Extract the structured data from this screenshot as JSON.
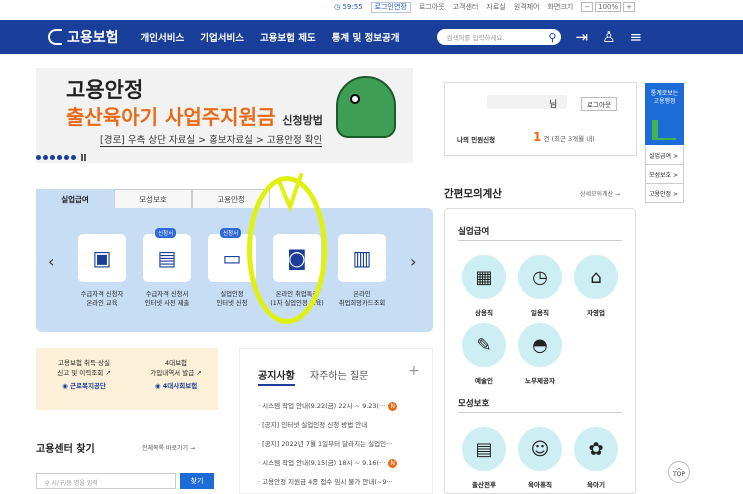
{
  "topbar": {
    "timer": "59:55",
    "extend": "로그인연장",
    "links": [
      "로그아웃",
      "고객센터",
      "자료실",
      "원격제어"
    ],
    "zoom_label": "화면크기",
    "zoom_minus": "−",
    "zoom_value": "100%",
    "zoom_plus": "+"
  },
  "header": {
    "logo": "고용보험",
    "nav": [
      "개인서비스",
      "기업서비스",
      "고용보험 제도",
      "통계 및 정보공개"
    ],
    "search_placeholder": "검색어를 입력하세요."
  },
  "banner": {
    "line1": "고용안정",
    "line2": "출산육아기 사업주지원금",
    "line2_suffix": "신청방법",
    "line3": "[경로] 우측 상단 자료실 > 홍보자료실 > 고용안정 확인"
  },
  "login": {
    "nim": "님",
    "logout": "로그아웃",
    "records_label": "나의 민원신청",
    "count": "1",
    "count_suffix": "건 (최근 3개월 내)"
  },
  "side": {
    "card": [
      "통계로보는",
      "고용행정"
    ],
    "links": [
      "실업급여 >",
      "모성보호 >",
      "고용안정 >"
    ]
  },
  "tabs": [
    "실업급여",
    "모성보호",
    "고용안정"
  ],
  "services": [
    {
      "tag": "",
      "l1": "수급자격 신청자",
      "l2": "온라인 교육"
    },
    {
      "tag": "신청서",
      "l1": "수급자격 신청서",
      "l2": "인터넷 사전 제출"
    },
    {
      "tag": "신청서",
      "l1": "실업인정",
      "l2": "인터넷 신청"
    },
    {
      "tag": "",
      "l1": "온라인 취업특강",
      "l2": "(1차 실업인정 교육)"
    },
    {
      "tag": "",
      "l1": "온라인",
      "l2": "취업희망카드조회"
    }
  ],
  "cards": {
    "a1": "고용보험 취득·상실",
    "a2": "신고 및 이력조회",
    "a3": "근로복지공단",
    "b1": "4대보험",
    "b2": "가입내역서 발급",
    "b3": "4대사회보험"
  },
  "center": {
    "title": "고용센터 찾기",
    "more": "전체목록 바로가기 →",
    "placeholder": "시/구/동 명을 입력",
    "button": "찾기"
  },
  "notice": {
    "tab1": "공지사항",
    "tab2": "자주하는 질문",
    "plus": "+",
    "badge": "N",
    "items": [
      "시스템 작업 안내(9.22(금) 22시 ~ 9.23(···",
      "[공지] 인터넷 실업인정 신청 방법 안내",
      "[공지] 2022년 7월 1일부터 달라지는 실업인···",
      "시스템 작업 안내(9.15(금) 18시 ~ 9.16(···",
      "고용안정 지원금 4종 접수 임시 불가 안내(~9···"
    ]
  },
  "calc": {
    "title": "간편모의계산",
    "more": "상세모의계산 →",
    "sec1": "실업급여",
    "sec2": "모성보호",
    "items1": [
      "상용직",
      "일용직",
      "자영업"
    ],
    "items2": [
      "예술인",
      "노무제공자"
    ],
    "items3": [
      "출산전후",
      "육아휴직",
      "육아기"
    ]
  },
  "top": "TOP"
}
